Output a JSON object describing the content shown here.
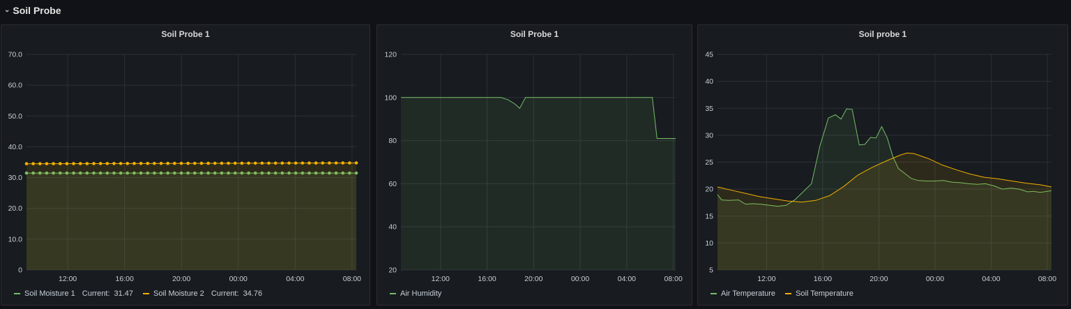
{
  "row": {
    "title": "Soil Probe",
    "chevron_icon": "chevron-down-icon"
  },
  "colors": {
    "green": "#73bf69",
    "yellow": "#fade2a",
    "orange": "#f2cc0c",
    "grid": "#2c3036",
    "background": "#181b1f"
  },
  "panels": [
    {
      "title": "Soil Probe 1",
      "chart_data": {
        "type": "line",
        "x_ticks": [
          "12:00",
          "16:00",
          "20:00",
          "00:00",
          "04:00",
          "08:00"
        ],
        "y_ticks": [
          "0",
          "10.0",
          "20.0",
          "30.0",
          "40.0",
          "50.0",
          "60.0",
          "70.0"
        ],
        "ylim": [
          0,
          70
        ],
        "xlim_hours": [
          9.1,
          32.3
        ],
        "points": true,
        "series": [
          {
            "name": "Soil Moisture 1",
            "current_label": "Current:",
            "current": "31.47",
            "color": "#73bf69",
            "x": [
              9.1,
              32.3
            ],
            "values": [
              31.47,
              31.47
            ]
          },
          {
            "name": "Soil Moisture 2",
            "current_label": "Current:",
            "current": "34.76",
            "color": "#f2b000",
            "x": [
              9.1,
              32.3
            ],
            "values": [
              34.5,
              34.76
            ]
          }
        ]
      }
    },
    {
      "title": "Soil Probe 1",
      "chart_data": {
        "type": "area",
        "x_ticks": [
          "12:00",
          "16:00",
          "20:00",
          "00:00",
          "04:00",
          "08:00"
        ],
        "y_ticks": [
          "20",
          "40",
          "60",
          "80",
          "100",
          "120"
        ],
        "ylim": [
          20,
          120
        ],
        "xlim_hours": [
          8.6,
          32.2
        ],
        "series": [
          {
            "name": "Air Humidity",
            "color": "#73bf69",
            "x": [
              8.6,
              16.7,
              17.2,
              17.8,
              18.4,
              18.8,
              19.3,
              19.8,
              30.2,
              30.6,
              32.2
            ],
            "values": [
              100,
              100,
              100,
              99,
              97,
              95,
              100,
              100,
              100,
              81,
              81
            ]
          }
        ]
      }
    },
    {
      "title": "Soil probe 1",
      "chart_data": {
        "type": "area",
        "x_ticks": [
          "12:00",
          "16:00",
          "20:00",
          "00:00",
          "04:00",
          "08:00"
        ],
        "y_ticks": [
          "5",
          "10",
          "15",
          "20",
          "25",
          "30",
          "35",
          "40",
          "45"
        ],
        "ylim": [
          5,
          45
        ],
        "xlim_hours": [
          8.5,
          32.3
        ],
        "series": [
          {
            "name": "Air Temperature",
            "color": "#73bf69",
            "x": [
              8.5,
              8.8,
              9.3,
              10.0,
              10.5,
              11.0,
              11.6,
              12.2,
              12.8,
              13.4,
              14.0,
              14.6,
              15.2,
              15.8,
              16.4,
              16.9,
              17.3,
              17.7,
              18.1,
              18.6,
              19.0,
              19.4,
              19.8,
              20.2,
              20.6,
              21.0,
              21.4,
              21.8,
              22.3,
              22.8,
              23.4,
              24.0,
              24.6,
              25.2,
              25.8,
              26.4,
              27.0,
              27.6,
              28.2,
              28.8,
              29.4,
              30.0,
              30.6,
              31.0,
              31.5,
              32.0,
              32.3
            ],
            "values": [
              19.0,
              18.0,
              17.9,
              18.0,
              17.2,
              17.3,
              17.2,
              17.0,
              16.8,
              17.0,
              18.0,
              19.5,
              21.0,
              28.0,
              33.2,
              33.8,
              33.0,
              34.9,
              34.8,
              28.2,
              28.3,
              29.6,
              29.5,
              31.6,
              29.5,
              26.0,
              23.8,
              23.0,
              22.0,
              21.6,
              21.5,
              21.5,
              21.6,
              21.3,
              21.2,
              21.0,
              20.9,
              21.0,
              20.6,
              20.0,
              20.2,
              20.0,
              19.5,
              19.6,
              19.4,
              19.6,
              19.7
            ]
          },
          {
            "name": "Soil Temperature",
            "color": "#f2b000",
            "x": [
              8.5,
              9.5,
              10.5,
              11.5,
              12.5,
              13.5,
              14.5,
              15.5,
              16.5,
              17.5,
              18.5,
              19.5,
              20.5,
              21.5,
              22.0,
              22.5,
              23.5,
              24.5,
              25.5,
              26.5,
              27.5,
              28.5,
              29.5,
              30.5,
              31.5,
              32.3
            ],
            "values": [
              20.4,
              19.8,
              19.2,
              18.6,
              18.2,
              17.8,
              17.6,
              17.9,
              18.8,
              20.5,
              22.6,
              24.0,
              25.2,
              26.3,
              26.7,
              26.6,
              25.7,
              24.5,
              23.6,
              22.8,
              22.2,
              21.9,
              21.5,
              21.1,
              20.8,
              20.4
            ]
          }
        ]
      }
    }
  ]
}
